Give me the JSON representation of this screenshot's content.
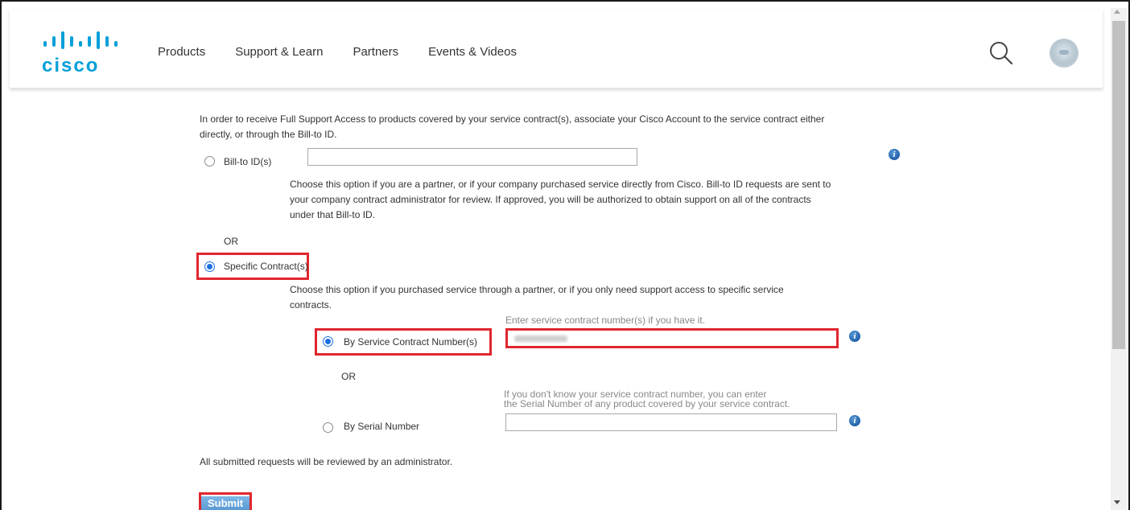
{
  "header": {
    "logo_text": "cisco",
    "nav": [
      "Products",
      "Support & Learn",
      "Partners",
      "Events & Videos"
    ]
  },
  "form": {
    "intro_line1": "In order to receive Full Support Access to products covered by your service contract(s), associate your Cisco Account to the service contract either",
    "intro_line2": "directly, or through the Bill-to ID.",
    "billto_label": "Bill-to ID(s)",
    "billto_value": "",
    "billto_desc1": "Choose this option if you are a partner, or if your company purchased service directly from Cisco. Bill-to ID requests are sent to",
    "billto_desc2": "your company contract administrator for review. If approved, you will be authorized to obtain support on all of the contracts",
    "billto_desc3": "under that Bill-to ID.",
    "or1": "OR",
    "specific_label": "Specific Contract(s)",
    "specific_desc1": "Choose this option if you purchased service through a partner, or if you only need support access to specific service",
    "specific_desc2": "contracts.",
    "contract_hint": "Enter service contract number(s) if you have it.",
    "contract_label": "By Service Contract Number(s)",
    "or2": "OR",
    "serial_hint1": "If you don't know your service contract number, you can enter",
    "serial_hint2": "the Serial Number of any product covered by your service contract.",
    "serial_label": "By Serial Number",
    "serial_value": "",
    "footer_note": "All submitted requests will be reviewed by an administrator.",
    "submit_label": "Submit",
    "selected_option": "Specific Contract(s)",
    "selected_sub_option": "By Service Contract Number(s)"
  },
  "colors": {
    "brand": "#049fd9",
    "highlight": "#e0262e",
    "radio_checked": "#1d6fe0"
  }
}
